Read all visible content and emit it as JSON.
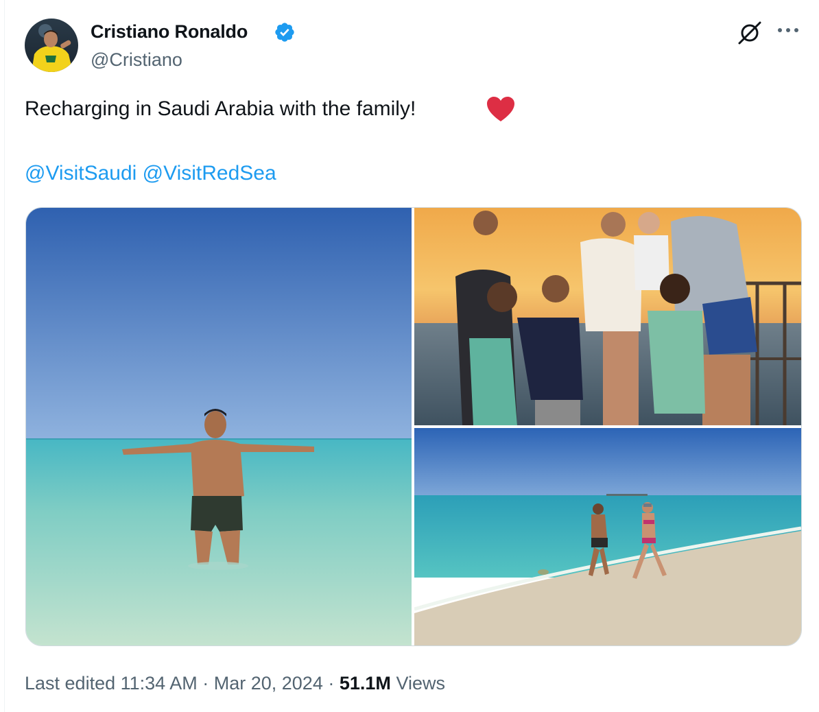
{
  "author": {
    "name": "Cristiano Ronaldo",
    "handle": "@Cristiano",
    "verified": true,
    "verified_color": "#1d9bf0"
  },
  "tweet": {
    "text": "Recharging in Saudi Arabia with the family!",
    "emoji": "red-heart",
    "mentions": [
      "@VisitSaudi",
      "@VisitRedSea"
    ]
  },
  "media": {
    "count": 3
  },
  "footer": {
    "edited_label": "Last edited",
    "time": "11:34 AM",
    "separator": "·",
    "date": "Mar 20, 2024",
    "views_count": "51.1M",
    "views_label": "Views"
  },
  "icons": {
    "grok": "grok-icon",
    "more": "more-icon",
    "verified": "verified-badge-icon"
  },
  "colors": {
    "text": "#0f1419",
    "secondary": "#536471",
    "link": "#1d9bf0",
    "border": "#cfd9de"
  }
}
